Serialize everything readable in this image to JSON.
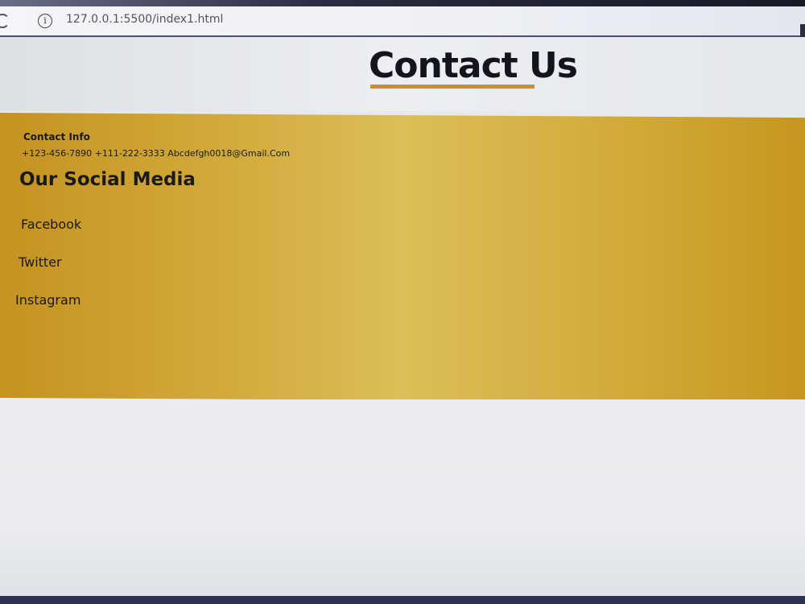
{
  "browser": {
    "url": "127.0.0.1:5500/index1.html",
    "info_icon": "info-icon",
    "reload_icon": "reload-icon"
  },
  "header": {
    "title": "Contact Us"
  },
  "contact": {
    "heading": "Contact Info",
    "details": "+123-456-7890 +111-222-3333 Abcdefgh0018@Gmail.Com"
  },
  "social": {
    "heading": "Our Social Media",
    "links": [
      "Facebook",
      "Twitter",
      "Instagram"
    ]
  },
  "colors": {
    "band": "#d0a73a",
    "underline": "#c7951f",
    "text": "#1a1a1a"
  }
}
